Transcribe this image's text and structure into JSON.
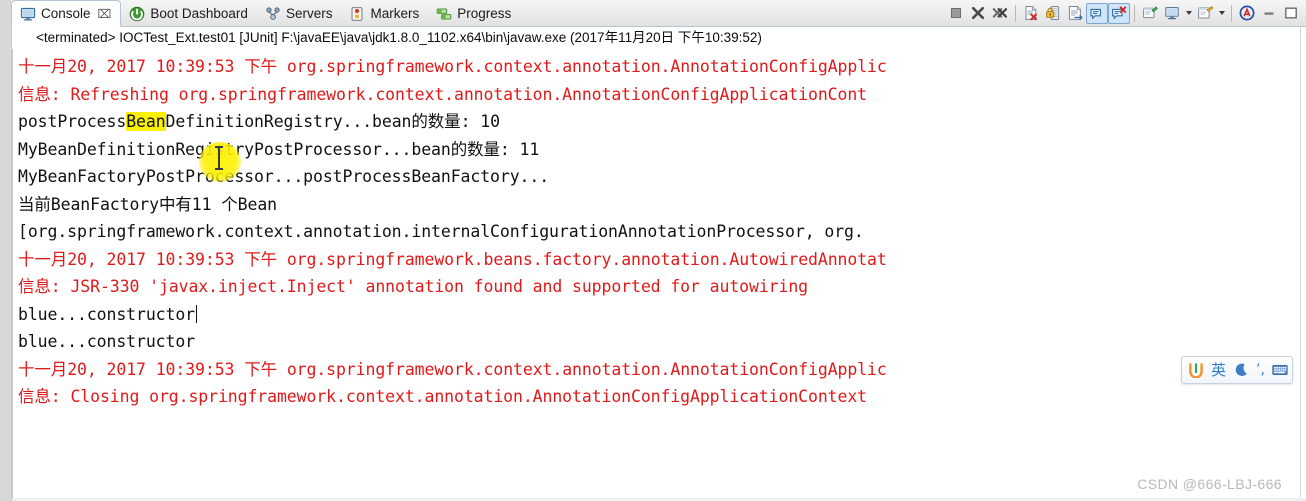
{
  "window": {
    "left_gutter": true
  },
  "tabs": [
    {
      "id": "console",
      "label": "Console",
      "icon": "console-icon",
      "active": true,
      "closable": true,
      "close_glyph": "⌧"
    },
    {
      "id": "boot-dashboard",
      "label": "Boot Dashboard",
      "icon": "boot-dashboard-icon",
      "active": false,
      "closable": false,
      "close_glyph": ""
    },
    {
      "id": "servers",
      "label": "Servers",
      "icon": "servers-icon",
      "active": false,
      "closable": false,
      "close_glyph": ""
    },
    {
      "id": "markers",
      "label": "Markers",
      "icon": "markers-icon",
      "active": false,
      "closable": false,
      "close_glyph": ""
    },
    {
      "id": "progress",
      "label": "Progress",
      "icon": "progress-icon",
      "active": false,
      "closable": false,
      "close_glyph": ""
    }
  ],
  "toolbar": {
    "buttons": [
      {
        "name": "terminate-button",
        "title": "Terminate",
        "type": "icon",
        "toggled": false
      },
      {
        "name": "remove-launch-button",
        "title": "Remove Launch",
        "type": "icon",
        "toggled": false
      },
      {
        "name": "remove-all-terminated-button",
        "title": "Remove All Terminated Launches",
        "type": "icon",
        "toggled": false
      },
      {
        "name": "separator-1",
        "title": "",
        "type": "sep",
        "toggled": false
      },
      {
        "name": "clear-console-button",
        "title": "Clear Console",
        "type": "icon",
        "toggled": false
      },
      {
        "name": "scroll-lock-button",
        "title": "Scroll Lock",
        "type": "icon",
        "toggled": false
      },
      {
        "name": "word-wrap-button",
        "title": "Word Wrap",
        "type": "icon",
        "toggled": false
      },
      {
        "name": "show-console-on-output-button",
        "title": "Show Console When Standard Out Changes",
        "type": "icon",
        "toggled": true
      },
      {
        "name": "show-console-on-error-button",
        "title": "Show Console When Standard Error Changes",
        "type": "icon",
        "toggled": true
      },
      {
        "name": "separator-2",
        "title": "",
        "type": "sep",
        "toggled": false
      },
      {
        "name": "pin-console-button",
        "title": "Pin Console",
        "type": "icon",
        "toggled": false
      },
      {
        "name": "display-selected-console-button",
        "title": "Display Selected Console",
        "type": "icon",
        "toggled": false
      },
      {
        "name": "display-selected-console-dropdown",
        "title": "Display Selected Console menu",
        "type": "arrow",
        "toggled": false
      },
      {
        "name": "open-console-button",
        "title": "Open Console",
        "type": "icon",
        "toggled": false
      },
      {
        "name": "open-console-dropdown",
        "title": "Open Console menu",
        "type": "arrow",
        "toggled": false
      },
      {
        "name": "separator-3",
        "title": "",
        "type": "sep",
        "toggled": false
      },
      {
        "name": "ansi-console-button",
        "title": "ANSI Console",
        "type": "icon",
        "toggled": false
      },
      {
        "name": "minimize-button",
        "title": "Minimize",
        "type": "icon",
        "toggled": false
      },
      {
        "name": "maximize-button",
        "title": "Maximize",
        "type": "icon",
        "toggled": false
      }
    ]
  },
  "launch": {
    "description": "<terminated> IOCTest_Ext.test01 [JUnit] F:\\javaEE\\java\\jdk1.8.0_1102.x64\\bin\\javaw.exe (2017年11月20日 下午10:39:52)"
  },
  "console": {
    "lines": [
      {
        "id": 1,
        "color": "red",
        "text": "十一月20, 2017 10:39:53 下午 org.springframework.context.annotation.AnnotationConfigApplic"
      },
      {
        "id": 2,
        "color": "red",
        "text": "信息: Refreshing org.springframework.context.annotation.AnnotationConfigApplicationCont"
      },
      {
        "id": 3,
        "color": "black",
        "text": "postProcessBeanDefinitionRegistry...bean的数量: 10",
        "highlight": "Bean",
        "highlight_index": 11
      },
      {
        "id": 4,
        "color": "black",
        "text": "MyBeanDefinitionRegistryPostProcessor...bean的数量: 11"
      },
      {
        "id": 5,
        "color": "black",
        "text": "MyBeanFactoryPostProcessor...postProcessBeanFactory..."
      },
      {
        "id": 6,
        "color": "black",
        "text": "当前BeanFactory中有11 个Bean"
      },
      {
        "id": 7,
        "color": "black",
        "text": "[org.springframework.context.annotation.internalConfigurationAnnotationProcessor, org."
      },
      {
        "id": 8,
        "color": "red",
        "text": "十一月20, 2017 10:39:53 下午 org.springframework.beans.factory.annotation.AutowiredAnnotat"
      },
      {
        "id": 9,
        "color": "red",
        "text": "信息: JSR-330 'javax.inject.Inject' annotation found and supported for autowiring"
      },
      {
        "id": 10,
        "color": "black",
        "text": "blue...constructor",
        "caret": true
      },
      {
        "id": 11,
        "color": "black",
        "text": "blue...constructor"
      },
      {
        "id": 12,
        "color": "red",
        "text": "十一月20, 2017 10:39:53 下午 org.springframework.context.annotation.AnnotationConfigApplic"
      },
      {
        "id": 13,
        "color": "red",
        "text": "信息: Closing org.springframework.context.annotation.AnnotationConfigApplicationContext"
      }
    ]
  },
  "ime": {
    "logo": "sogou-logo-icon",
    "lang": "英",
    "moon": "moon-icon",
    "punctuation": "’,",
    "keyboard": "soft-keyboard-icon"
  },
  "watermark": {
    "text": "CSDN @666-LBJ-666"
  },
  "colors": {
    "console_red": "#e01a1a",
    "console_black": "#111111",
    "highlight_yellow": "#fbf000",
    "tab_active_bg": "#ffffff",
    "toolbar_toggle_bg": "#cfe4f7"
  }
}
